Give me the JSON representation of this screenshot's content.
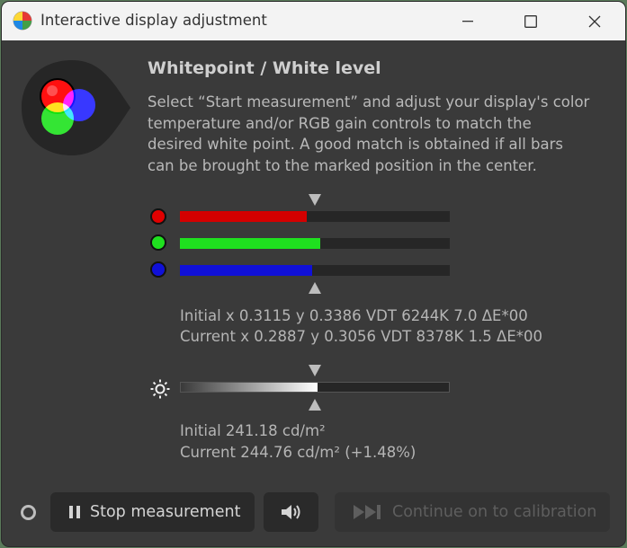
{
  "window": {
    "title": "Interactive display adjustment"
  },
  "header": {
    "heading": "Whitepoint / White level",
    "description": "Select “Start measurement” and adjust your display's color\ntemperature and/or RGB gain controls to match the\ndesired white point. A good match is obtained if all bars\ncan be brought to the marked position in the center."
  },
  "rgb_bars": [
    {
      "channel": "red",
      "color": "#d40000",
      "level": 0.47
    },
    {
      "channel": "green",
      "color": "#1fe01f",
      "level": 0.52
    },
    {
      "channel": "blue",
      "color": "#1010d8",
      "level": 0.49
    }
  ],
  "whitepoint": {
    "initial": "Initial x 0.3115 y 0.3386 VDT 6244K 7.0 ΔE*00",
    "current": "Current x 0.2887 y 0.3056 VDT 8378K 1.5 ΔE*00"
  },
  "luminance": {
    "level": 0.51,
    "initial": "Initial 241.18 cd/m²",
    "current": "Current 244.76 cd/m² (+1.48%)"
  },
  "buttons": {
    "stop": "Stop measurement",
    "continue": "Continue on to calibration"
  },
  "icons": {
    "app": "displaycal-icon",
    "stop": "pause-icon",
    "sound": "speaker-icon",
    "continue": "skip-forward-icon",
    "luminance": "sun-icon"
  }
}
